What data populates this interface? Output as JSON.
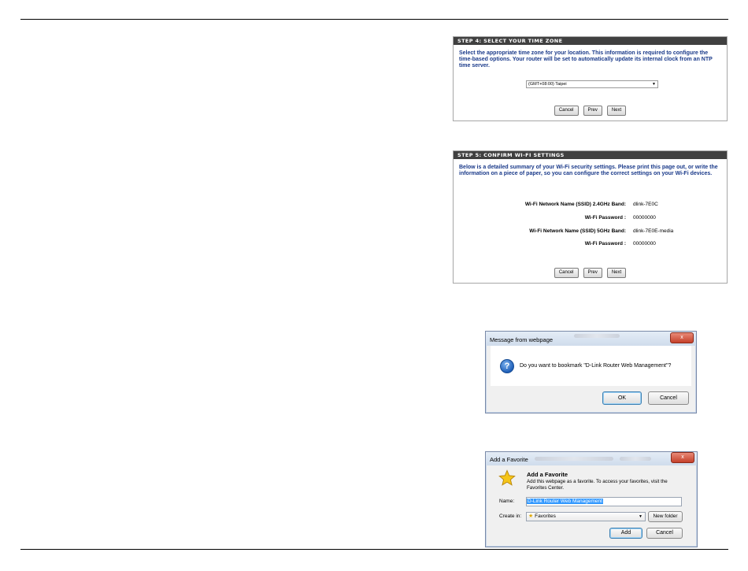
{
  "step4": {
    "title": "STEP 4: SELECT YOUR TIME ZONE",
    "description": "Select the appropriate time zone for your location. This information is required to configure the time-based options. Your router will be set to automatically update its internal clock from an NTP time server.",
    "timezone_value": "(GMT+08:00) Taipei",
    "buttons": {
      "cancel": "Cancel",
      "prev": "Prev",
      "next": "Next"
    }
  },
  "step5": {
    "title": "STEP 5: CONFIRM WI-FI SETTINGS",
    "description": "Below is a detailed summary of your Wi-Fi security settings. Please print this page out, or write the information on a piece of paper, so you can configure the correct settings on your Wi-Fi devices.",
    "rows": [
      {
        "label": "Wi-Fi Network Name (SSID)  2.4GHz Band:",
        "value": "dlink-7E0C"
      },
      {
        "label": "Wi-Fi Password :",
        "value": "00000000"
      },
      {
        "label": "Wi-Fi Network Name (SSID)  5GHz Band:",
        "value": "dlink-7E0E-media"
      },
      {
        "label": "Wi-Fi Password :",
        "value": "00000000"
      }
    ],
    "buttons": {
      "cancel": "Cancel",
      "prev": "Prev",
      "next": "Next"
    }
  },
  "message_dialog": {
    "title": "Message from webpage",
    "close": "x",
    "icon": "question-icon",
    "message": "Do you want to bookmark \"D-Link Router Web Management\"?",
    "ok": "OK",
    "cancel": "Cancel"
  },
  "favorite_dialog": {
    "title": "Add a Favorite",
    "close": "x",
    "icon": "star-icon",
    "heading": "Add a Favorite",
    "subtext": "Add this webpage as a favorite. To access your favorites, visit the Favorites Center.",
    "name_label": "Name:",
    "name_value": "D-Link Router Web Management",
    "create_in_label": "Create in:",
    "create_in_value": "Favorites",
    "new_folder": "New folder",
    "add": "Add",
    "cancel": "Cancel"
  },
  "colors": {
    "panel_header": "#404040",
    "description_text": "#1a3a8a",
    "selection": "#3399ff",
    "close_button": "#c5402a"
  }
}
